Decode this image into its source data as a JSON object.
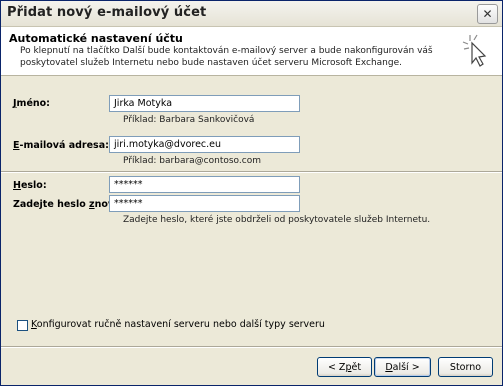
{
  "window": {
    "title": "Přidat nový e-mailový účet"
  },
  "header": {
    "title": "Automatické nastavení účtu",
    "description": "Po klepnutí na tlačítko Další bude kontaktován e-mailový server a bude nakonfigurován váš poskytovatel služeb Internetu nebo bude nastaven účet serveru Microsoft Exchange.",
    "icon": "sparkle-cursor-icon"
  },
  "form": {
    "name": {
      "label_underlined": "J",
      "label_rest": "méno:",
      "value": "Jirka Motyka",
      "hint": "Příklad: Barbara Sankovičová"
    },
    "email": {
      "label_underlined": "E",
      "label_rest": "-mailová adresa:",
      "value": "jiri.motyka@dvorec.eu",
      "hint": "Příklad: barbara@contoso.com"
    },
    "password": {
      "label_underlined": "H",
      "label_rest": "eslo:",
      "value": "******"
    },
    "password_confirm": {
      "label_prefix": "Zadejte heslo ",
      "label_underlined": "z",
      "label_rest": "novu:",
      "value": "******",
      "hint": "Zadejte heslo, které jste obdrželi od poskytovatele služeb Internetu."
    }
  },
  "manual_config": {
    "label_underlined": "K",
    "label_rest": "onfigurovat ručně nastavení serveru nebo další typy serveru",
    "checked": false
  },
  "buttons": {
    "back": {
      "prefix": "< Z",
      "underlined": "p",
      "suffix": "ět"
    },
    "next": {
      "underlined": "D",
      "suffix": "alší >"
    },
    "cancel": "Storno"
  },
  "colors": {
    "title_bar": "#f0efe8",
    "dialog": "#ece9d8",
    "input_border": "#7f9db9",
    "button_border": "#003c74"
  }
}
